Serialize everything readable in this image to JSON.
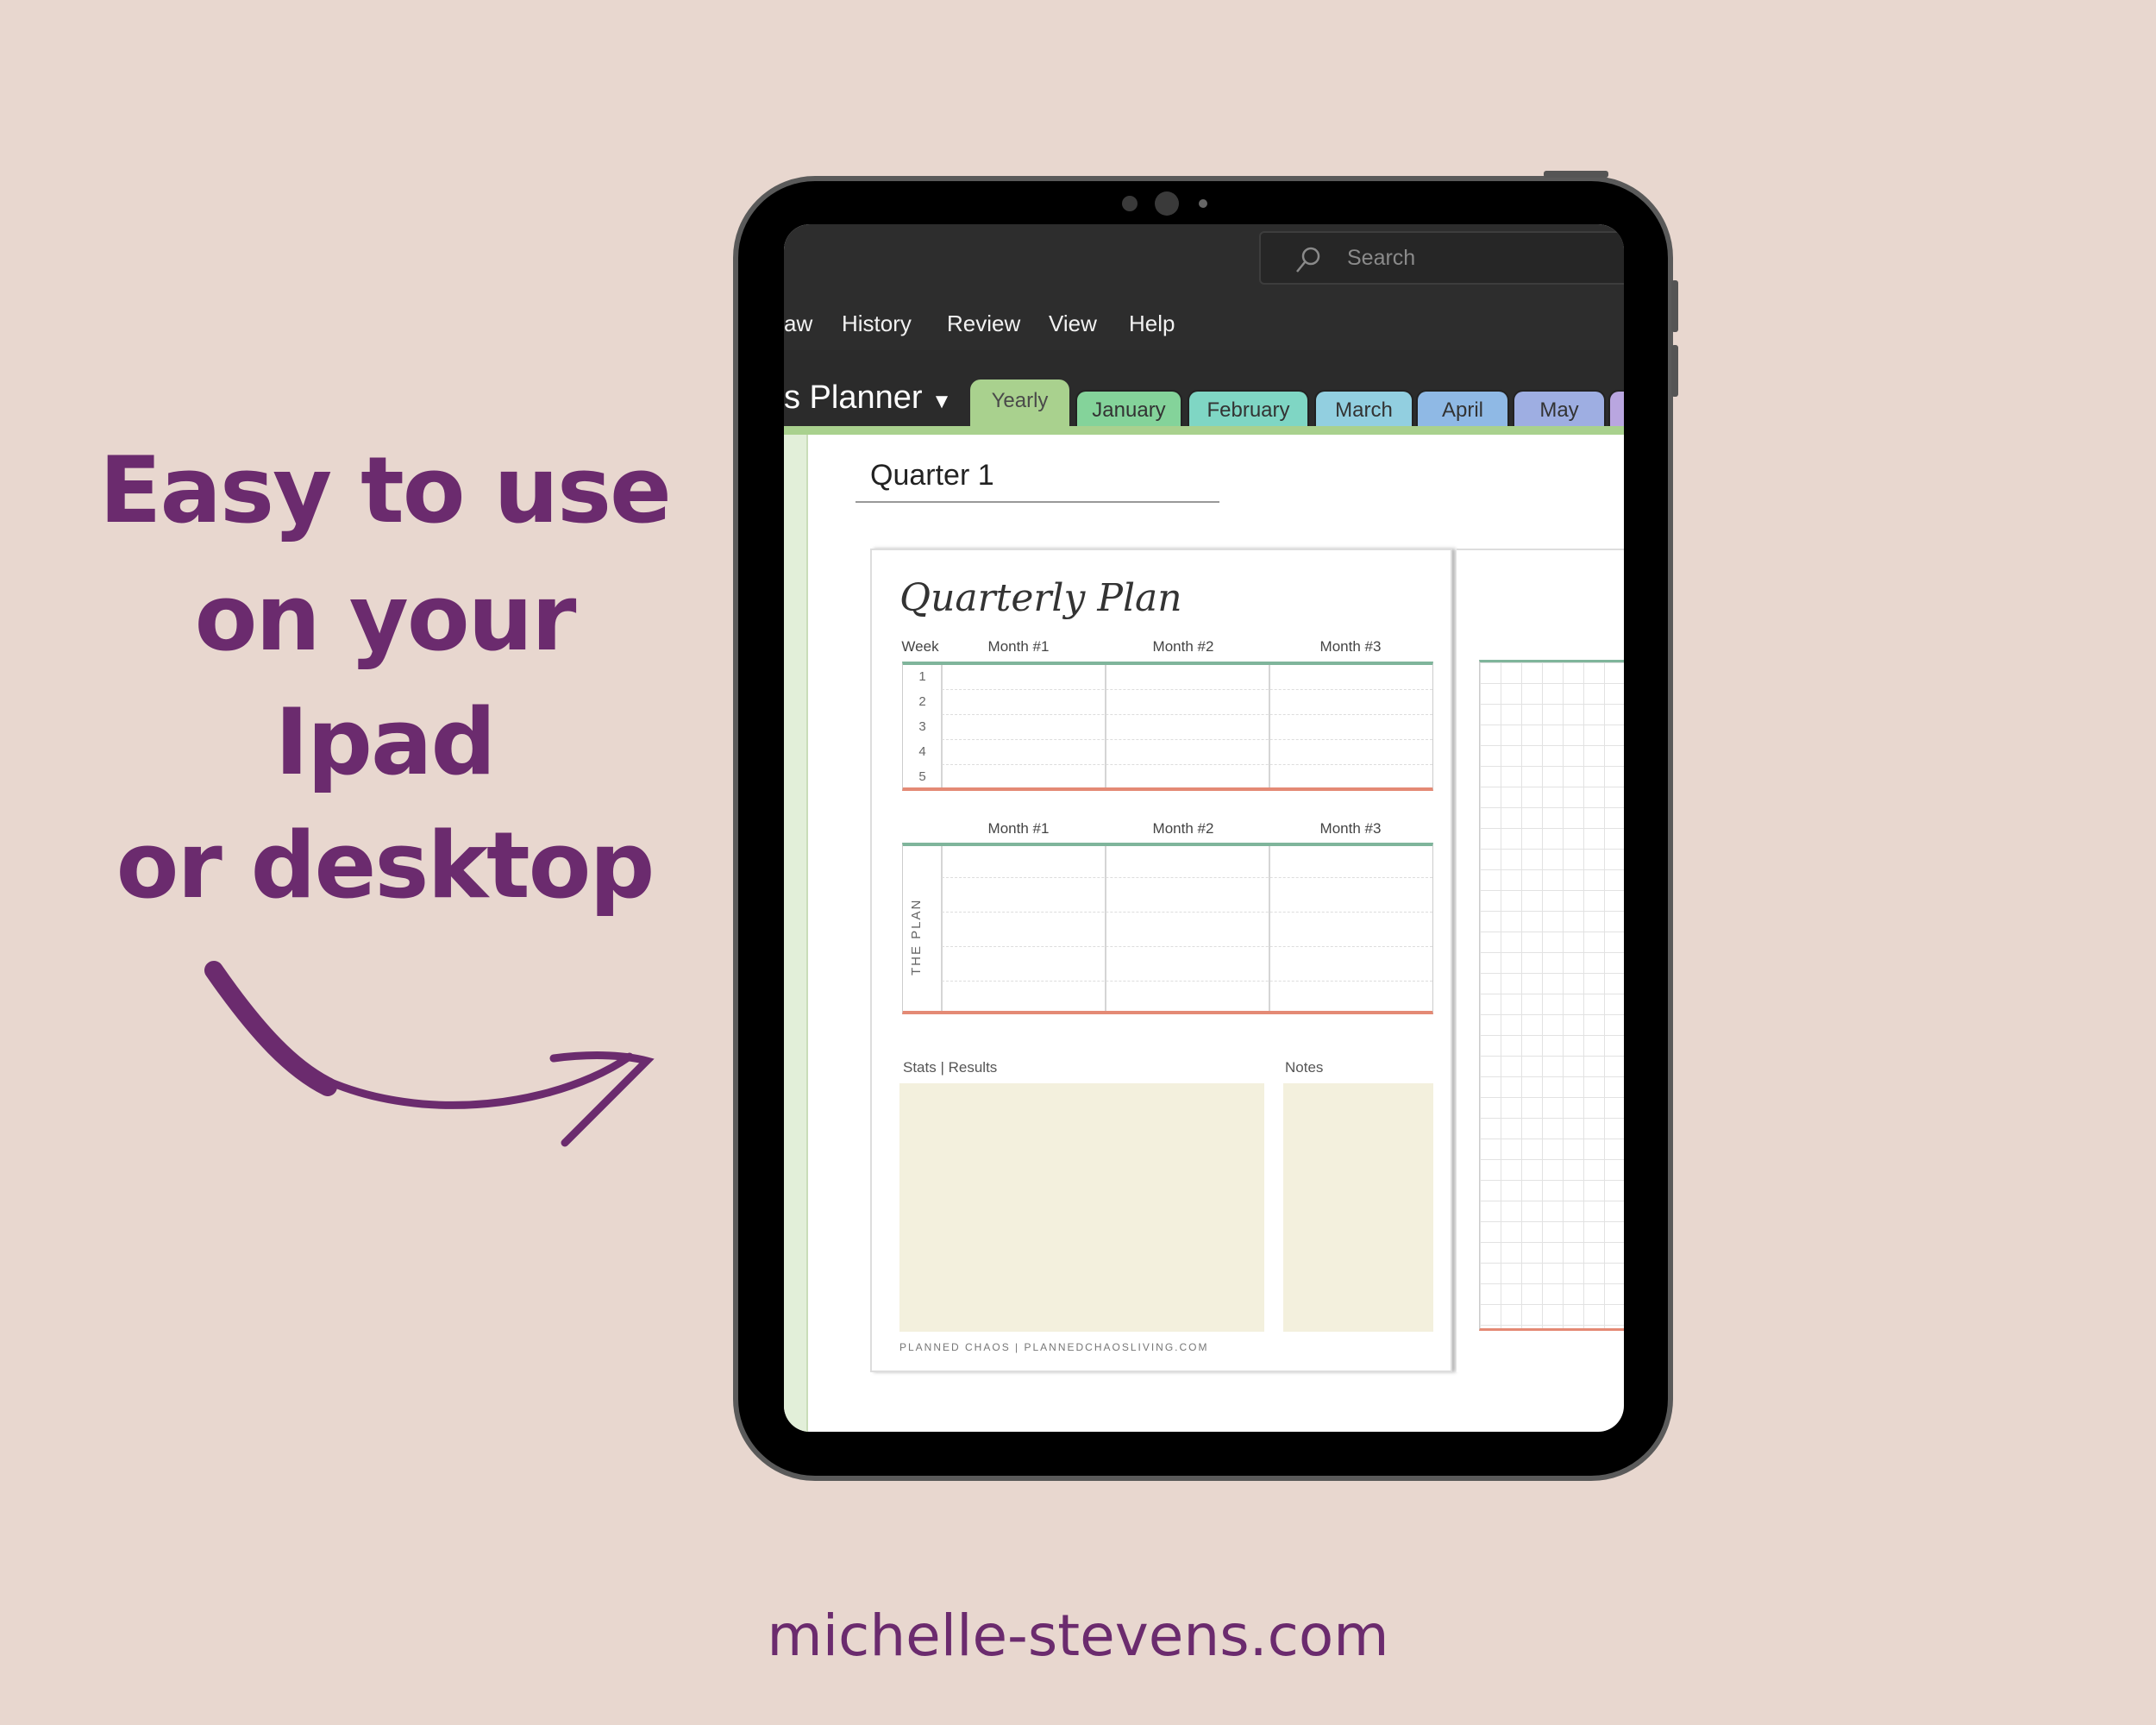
{
  "promo": {
    "lines": [
      "Easy to use",
      "on your",
      "Ipad",
      "or desktop"
    ],
    "website": "michelle-stevens.com",
    "color": "#6b2b6e"
  },
  "app": {
    "search_placeholder": "Search",
    "menu": [
      "aw",
      "History",
      "Review",
      "View",
      "Help"
    ],
    "notebook": "s Planner",
    "tabs": [
      {
        "label": "Yearly",
        "color": "#a9d18e",
        "active": true
      },
      {
        "label": "January",
        "color": "#84d39a"
      },
      {
        "label": "February",
        "color": "#7fd6c4"
      },
      {
        "label": "March",
        "color": "#92cfe0"
      },
      {
        "label": "April",
        "color": "#8fb9e5"
      },
      {
        "label": "May",
        "color": "#9eaee2"
      },
      {
        "label": "",
        "color": "#b9a6e0"
      }
    ],
    "page_title": "Quarter 1"
  },
  "planner": {
    "title": "Quarterly Plan",
    "week_label": "Week",
    "months": [
      "Month #1",
      "Month #2",
      "Month #3"
    ],
    "weeks": [
      "1",
      "2",
      "3",
      "4",
      "5"
    ],
    "plan_label": "THE PLAN",
    "stats_label": "Stats | Results",
    "notes_label": "Notes",
    "footer": "PLANNED CHAOS | PLANNEDCHAOSLIVING.COM"
  }
}
